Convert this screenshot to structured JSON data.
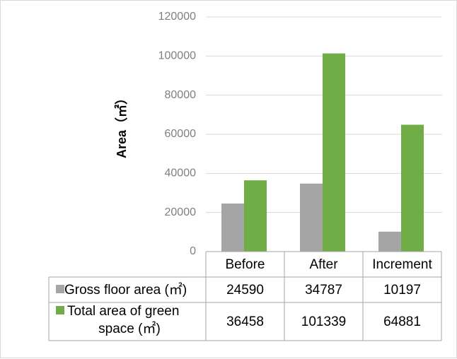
{
  "chart_data": {
    "type": "bar",
    "categories": [
      "Before",
      "After",
      "Increment"
    ],
    "series": [
      {
        "name": "Gross floor area (㎡)",
        "values": [
          24590,
          34787,
          10197
        ],
        "color": "#a5a5a5"
      },
      {
        "name": "Total area of green space (㎡)",
        "values": [
          36458,
          101339,
          64881
        ],
        "color": "#70ad47"
      }
    ],
    "ylabel": "Area（㎡）",
    "ylim": [
      0,
      120000
    ],
    "yticks": [
      0,
      20000,
      40000,
      60000,
      80000,
      100000,
      120000
    ],
    "grid": true,
    "legend": "data-table",
    "data_table": true
  }
}
